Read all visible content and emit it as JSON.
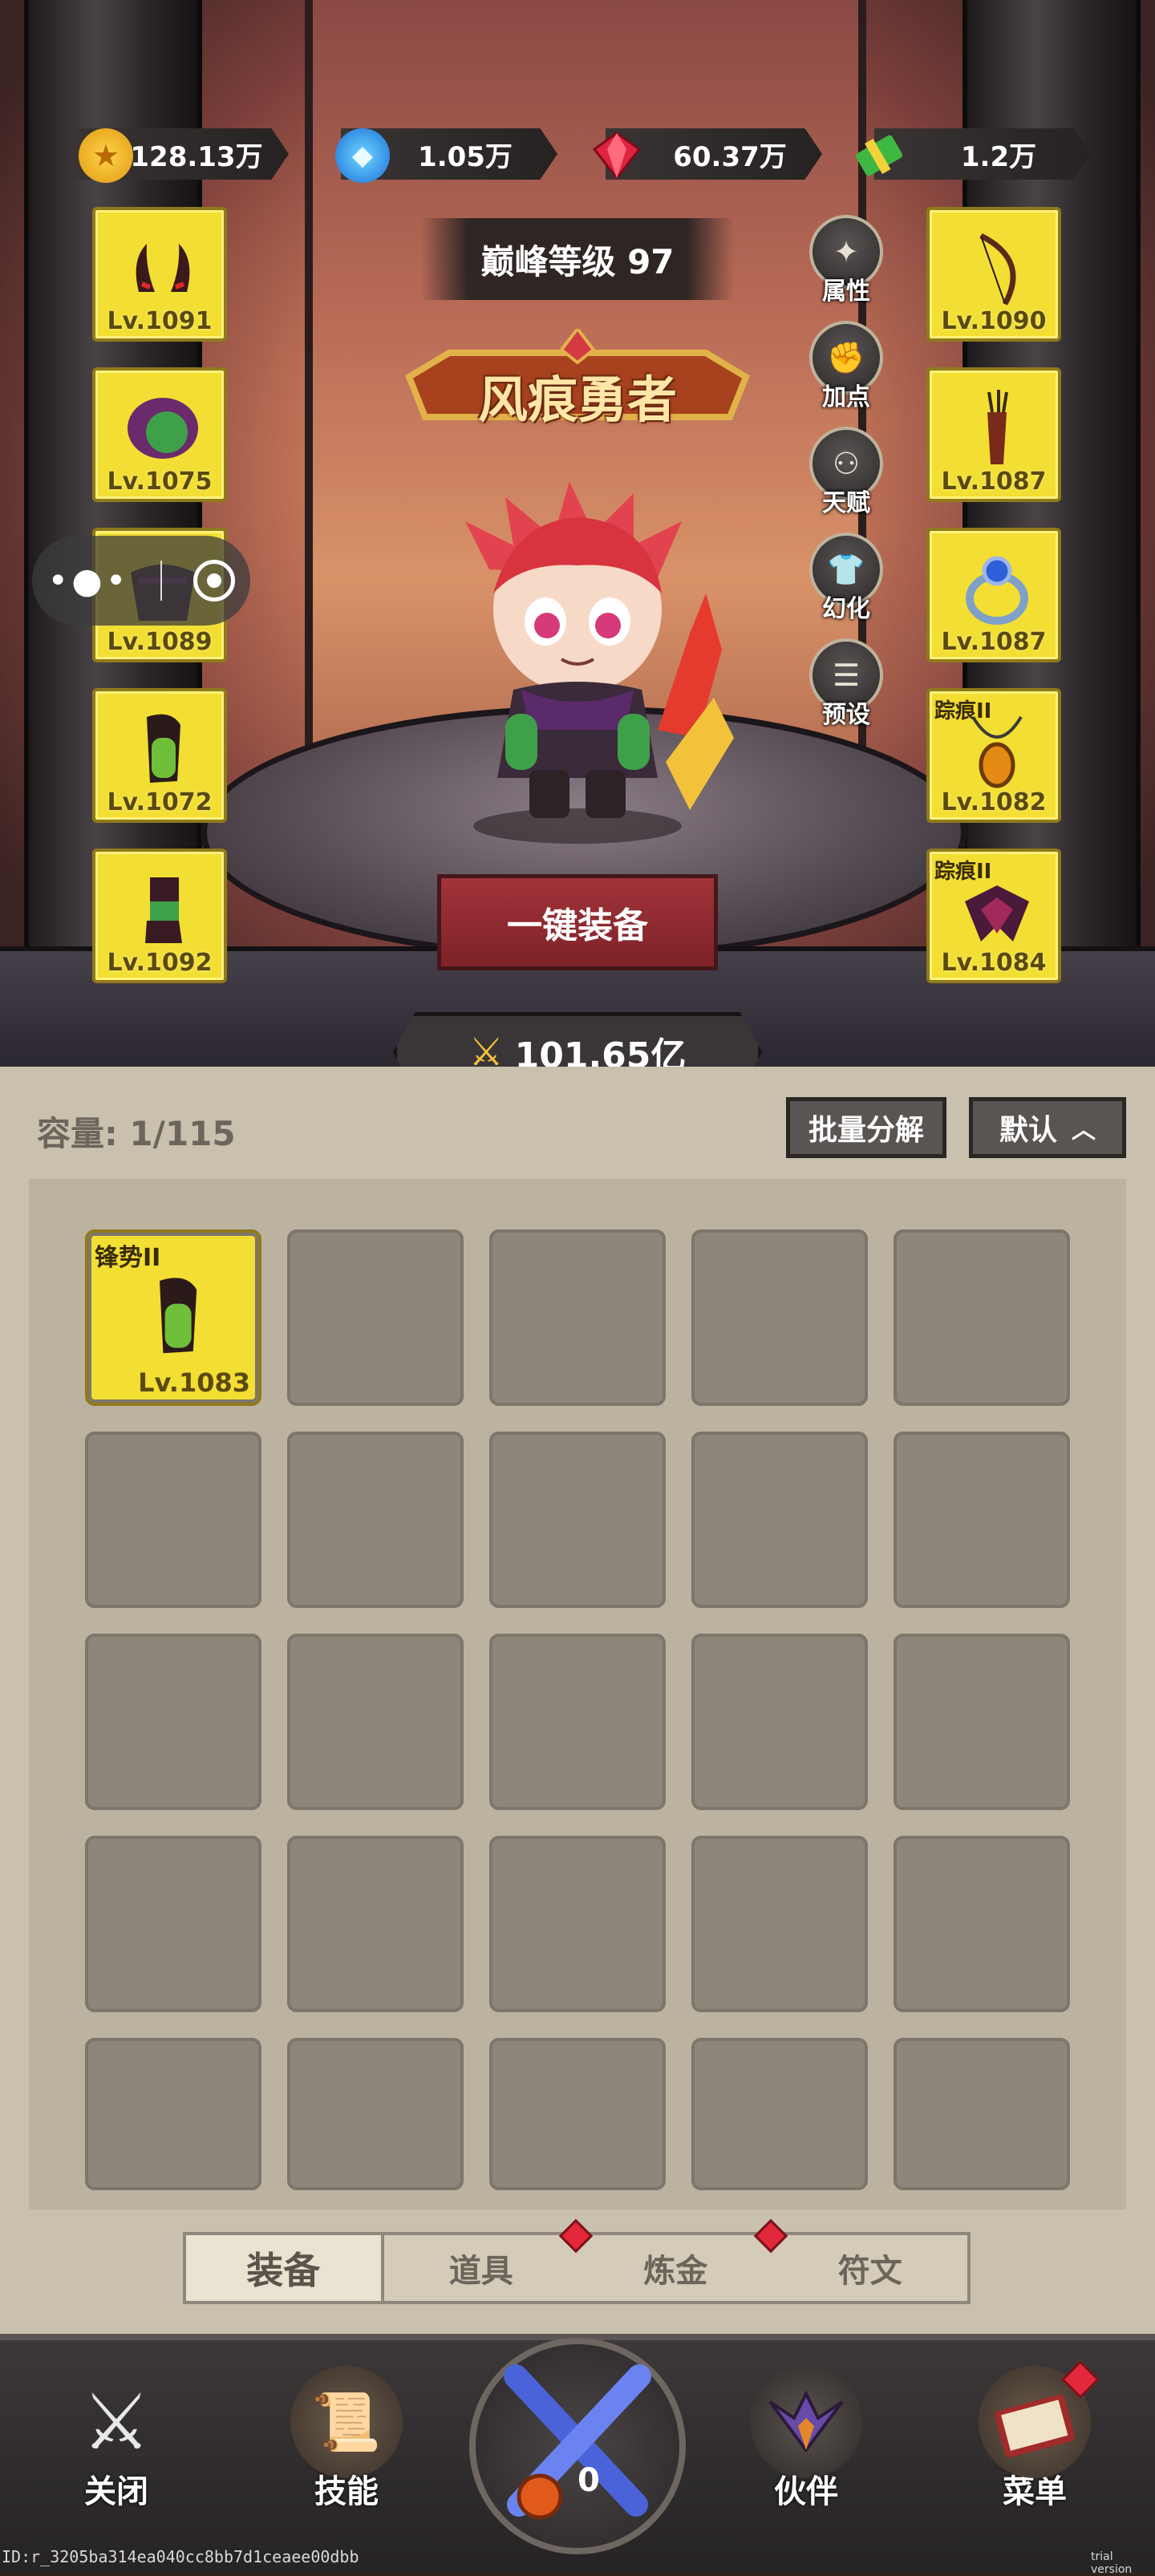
{
  "currencies": [
    {
      "icon": "gold-coin-icon",
      "value": "128.13万"
    },
    {
      "icon": "blue-crystal-icon",
      "value": "1.05万"
    },
    {
      "icon": "red-gem-icon",
      "value": "60.37万"
    },
    {
      "icon": "green-cash-icon",
      "value": "1.2万"
    }
  ],
  "hero": {
    "peak_level_label": "巅峰等级 97",
    "title": "风痕勇者",
    "equip_all_label": "一键装备",
    "power": "101.65亿"
  },
  "left_slots": [
    {
      "level": "Lv.1091",
      "item": "horns-helmet-icon"
    },
    {
      "level": "Lv.1075",
      "item": "purple-hood-icon"
    },
    {
      "level": "Lv.1089",
      "item": "chest-armor-icon"
    },
    {
      "level": "Lv.1072",
      "item": "green-pants-icon"
    },
    {
      "level": "Lv.1092",
      "item": "boots-icon"
    }
  ],
  "right_slots": [
    {
      "level": "Lv.1090",
      "item": "bow-icon",
      "tag": ""
    },
    {
      "level": "Lv.1087",
      "item": "quiver-icon",
      "tag": ""
    },
    {
      "level": "Lv.1087",
      "item": "ring-icon",
      "tag": ""
    },
    {
      "level": "Lv.1082",
      "item": "amulet-icon",
      "tag": "踪痕II"
    },
    {
      "level": "Lv.1084",
      "item": "wings-emblem-icon",
      "tag": "踪痕II"
    }
  ],
  "side_menu": [
    {
      "label": "属性",
      "icon": "attributes-icon"
    },
    {
      "label": "加点",
      "icon": "fist-icon"
    },
    {
      "label": "天赋",
      "icon": "talent-tree-icon"
    },
    {
      "label": "幻化",
      "icon": "outfit-icon"
    },
    {
      "label": "预设",
      "icon": "sliders-icon"
    }
  ],
  "inventory": {
    "capacity": "容量: 1/115",
    "batch_decompose": "批量分解",
    "sort_default": "默认",
    "items": [
      {
        "tag": "锋势II",
        "level": "Lv.1083",
        "item": "green-pants-icon"
      }
    ]
  },
  "tabs": [
    {
      "label": "装备",
      "active": true,
      "badge": false
    },
    {
      "label": "道具",
      "active": false,
      "badge": true
    },
    {
      "label": "炼金",
      "active": false,
      "badge": true
    },
    {
      "label": "符文",
      "active": false,
      "badge": false
    }
  ],
  "nav": [
    {
      "label": "关闭",
      "icon": "close-swords-icon"
    },
    {
      "label": "技能",
      "icon": "skill-scroll-icon"
    },
    {
      "label": "伙伴",
      "icon": "partner-wings-icon"
    },
    {
      "label": "菜单",
      "icon": "menu-book-icon"
    }
  ],
  "center_counter": "0",
  "footer": {
    "id_text": "ID:r_3205ba314ea040cc8bb7d1ceaee00dbb",
    "watermark": "trial version"
  }
}
